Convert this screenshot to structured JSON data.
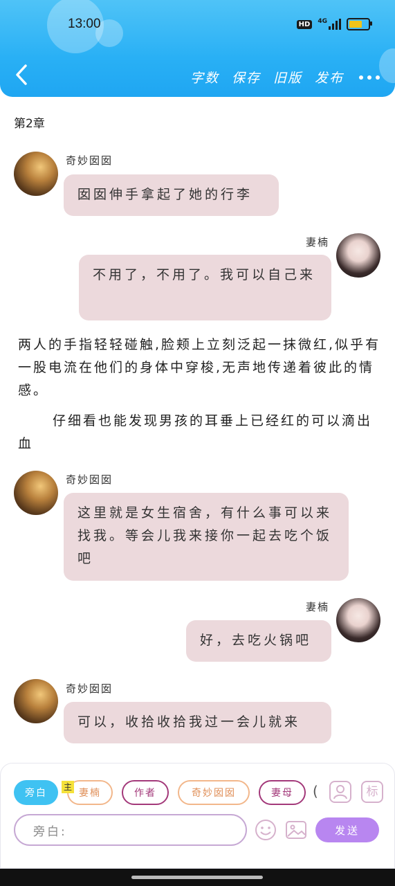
{
  "status": {
    "time": "13:00",
    "hd": "HD",
    "network": "4G"
  },
  "header": {
    "back_icon": "chevron-left-icon",
    "nav": [
      {
        "label": "字数"
      },
      {
        "label": "保存"
      },
      {
        "label": "旧版"
      },
      {
        "label": "发布"
      }
    ],
    "more_icon": "more-dots-icon"
  },
  "chapter": {
    "title": "第2章"
  },
  "messages": [
    {
      "speaker": "奇妙囡囡",
      "text": "囡囡伸手拿起了她的行李"
    },
    {
      "speaker": "妻楠",
      "text": "不用了，不用了。我可以自己来"
    },
    {
      "narration_1": "两人的手指轻轻碰触,脸颊上立刻泛起一抹微红,似乎有一股电流在他们的身体中穿梭,无声地传递着彼此的情感。",
      "narration_2": "仔细看也能发现男孩的耳垂上已经红的可以滴出血"
    },
    {
      "speaker": "奇妙囡囡",
      "text": "这里就是女生宿舍，有什么事可以来找我。等会儿我来接你一起去吃个饭吧"
    },
    {
      "speaker": "妻楠",
      "text": "好，去吃火锅吧"
    },
    {
      "speaker": "奇妙囡囡",
      "text": "可以，收拾收拾我过一会儿就来"
    }
  ],
  "composer": {
    "roles": [
      {
        "label": "旁白"
      },
      {
        "label": "妻楠"
      },
      {
        "label": "作者"
      },
      {
        "label": "奇妙囡囡"
      },
      {
        "label": "妻母"
      }
    ],
    "main_badge": "主",
    "partial_chip": "(",
    "person_icon": "person-icon",
    "tag_label": "标",
    "input_placeholder": "旁白:",
    "emoji_icon": "emoji-icon",
    "image_icon": "image-icon",
    "send_label": "发送"
  },
  "colors": {
    "header": "#29b0f5",
    "bubble": "#ecd9dc",
    "send": "#b886f0",
    "active_chip": "#3fc2f2"
  }
}
